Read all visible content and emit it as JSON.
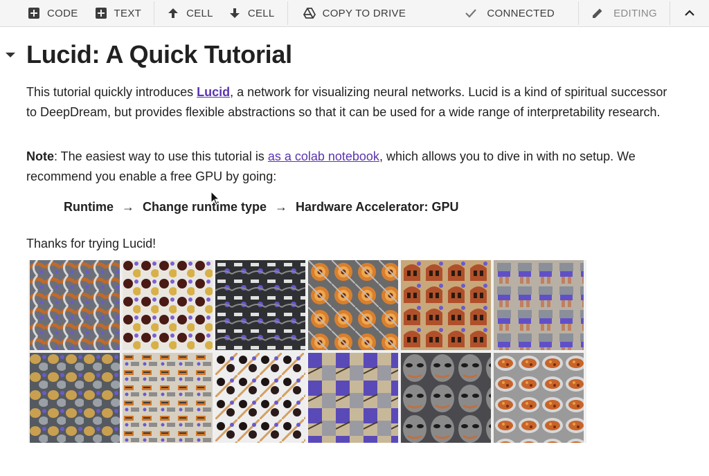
{
  "toolbar": {
    "code_label": "CODE",
    "text_label": "TEXT",
    "cell_up_label": "CELL",
    "cell_down_label": "CELL",
    "copy_drive_label": "COPY TO DRIVE",
    "connected_label": "CONNECTED",
    "editing_label": "EDITING",
    "icons": [
      "plus-box-icon",
      "plus-box-icon",
      "arrow-up-icon",
      "arrow-down-icon",
      "drive-icon",
      "check-icon",
      "pencil-icon",
      "chevron-up-icon"
    ]
  },
  "notebook": {
    "title": "Lucid: A Quick Tutorial",
    "intro_pre": "This tutorial quickly introduces ",
    "intro_link": "Lucid",
    "intro_post": ", a network for visualizing neural networks. Lucid is a kind of spiritual successor to DeepDream, but provides flexible abstractions so that it can be used for a wide range of interpretability research.",
    "note_label": "Note",
    "note_pre": ": The easiest way to use this tutorial is ",
    "note_link": "as a colab notebook",
    "note_post": ", which allows you to dive in with no setup. We recommend you enable a free GPU by going:",
    "path_step1": "Runtime",
    "path_arrow1": "→",
    "path_step2": "Change runtime type",
    "path_arrow2": "→",
    "path_step3": "Hardware Accelerator: GPU",
    "thanks": "Thanks for trying Lucid!"
  },
  "colors": {
    "link": "#5a34b0",
    "toolbar_bg": "#f5f5f5",
    "text": "#212121"
  }
}
